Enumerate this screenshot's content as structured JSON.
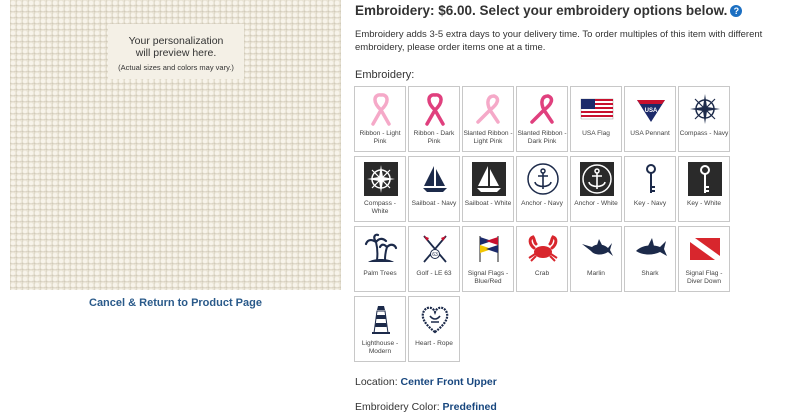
{
  "preview": {
    "line1": "Your personalization",
    "line2": "will preview here.",
    "line3": "(Actual sizes and colors may vary.)"
  },
  "cancel_link": "Cancel & Return to Product Page",
  "heading": "Embroidery: $6.00. Select your embroidery options below.",
  "help_icon": "question-icon",
  "info": "Embroidery adds 3-5 extra days to your delivery time. To order multiples of this item with different embroidery, please order items one at a time.",
  "section_label": "Embroidery:",
  "options": [
    {
      "label": "Ribbon - Light Pink",
      "icon": "ribbon-icon"
    },
    {
      "label": "Ribbon - Dark Pink",
      "icon": "ribbon-icon"
    },
    {
      "label": "Slanted Ribbon - Light Pink",
      "icon": "slanted-ribbon-icon"
    },
    {
      "label": "Slanted Ribbon - Dark Pink",
      "icon": "slanted-ribbon-icon"
    },
    {
      "label": "USA Flag",
      "icon": "usa-flag-icon"
    },
    {
      "label": "USA Pennant",
      "icon": "pennant-icon"
    },
    {
      "label": "Compass - Navy",
      "icon": "compass-icon"
    },
    {
      "label": "Compass - White",
      "icon": "compass-icon"
    },
    {
      "label": "Sailboat - Navy",
      "icon": "sailboat-icon"
    },
    {
      "label": "Sailboat - White",
      "icon": "sailboat-icon"
    },
    {
      "label": "Anchor - Navy",
      "icon": "anchor-icon"
    },
    {
      "label": "Anchor - White",
      "icon": "anchor-icon"
    },
    {
      "label": "Key - Navy",
      "icon": "key-icon"
    },
    {
      "label": "Key - White",
      "icon": "key-icon"
    },
    {
      "label": "Palm Trees",
      "icon": "palm-trees-icon"
    },
    {
      "label": "Golf - LE 63",
      "icon": "golf-icon"
    },
    {
      "label": "Signal Flags - Blue/Red",
      "icon": "signal-flags-icon"
    },
    {
      "label": "Crab",
      "icon": "crab-icon"
    },
    {
      "label": "Marlin",
      "icon": "marlin-icon"
    },
    {
      "label": "Shark",
      "icon": "shark-icon"
    },
    {
      "label": "Signal Flag - Diver Down",
      "icon": "diver-down-flag-icon"
    },
    {
      "label": "Lighthouse - Modern",
      "icon": "lighthouse-icon"
    },
    {
      "label": "Heart - Rope",
      "icon": "rope-heart-icon"
    }
  ],
  "location": {
    "label": "Location:",
    "value": "Center Front Upper"
  },
  "embroidery_color": {
    "label": "Embroidery Color:",
    "value": "Predefined"
  },
  "colors": {
    "navy": "#1c2a4a",
    "light_pink": "#f5a9c8",
    "dark_pink": "#e0407e",
    "link": "#2a5a8a"
  }
}
